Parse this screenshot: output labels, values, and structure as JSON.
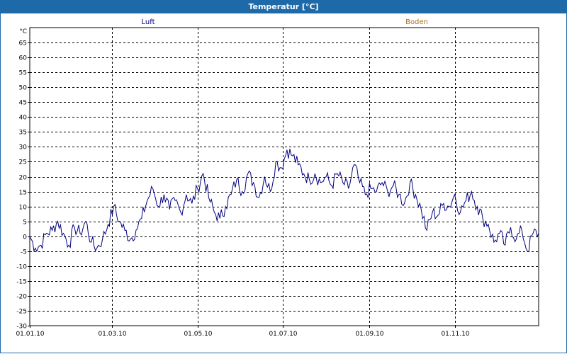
{
  "window": {
    "title": "Temperatur [°C]"
  },
  "chart_data": {
    "type": "line",
    "ylabel": "°C",
    "ylim": [
      -30,
      70
    ],
    "yticks": [
      65,
      60,
      55,
      50,
      45,
      40,
      35,
      30,
      25,
      20,
      15,
      10,
      5,
      0,
      -5,
      -10,
      -15,
      -20,
      -25,
      -30
    ],
    "xlim": [
      "2010-01-01",
      "2010-12-31"
    ],
    "xticks": [
      {
        "date": "2010-01-01",
        "label": "01.01.10"
      },
      {
        "date": "2010-03-01",
        "label": "01.03.10"
      },
      {
        "date": "2010-05-01",
        "label": "01.05.10"
      },
      {
        "date": "2010-07-01",
        "label": "01.07.10"
      },
      {
        "date": "2010-09-01",
        "label": "01.09.10"
      },
      {
        "date": "2010-11-01",
        "label": "01.11.10"
      }
    ],
    "grid": true,
    "legend_position": "top",
    "series": [
      {
        "name": "Luft",
        "color": "#000080",
        "points": [
          [
            "2010-01-01",
            0
          ],
          [
            "2010-01-05",
            -4
          ],
          [
            "2010-01-09",
            -3
          ],
          [
            "2010-01-13",
            1
          ],
          [
            "2010-01-17",
            2
          ],
          [
            "2010-01-21",
            5
          ],
          [
            "2010-01-25",
            1
          ],
          [
            "2010-01-29",
            -3
          ],
          [
            "2010-02-02",
            3
          ],
          [
            "2010-02-06",
            1
          ],
          [
            "2010-02-10",
            5
          ],
          [
            "2010-02-14",
            -2
          ],
          [
            "2010-02-18",
            -4
          ],
          [
            "2010-02-22",
            -1
          ],
          [
            "2010-02-26",
            4
          ],
          [
            "2010-03-02",
            10
          ],
          [
            "2010-03-06",
            5
          ],
          [
            "2010-03-10",
            2
          ],
          [
            "2010-03-14",
            -1
          ],
          [
            "2010-03-18",
            2
          ],
          [
            "2010-03-22",
            6
          ],
          [
            "2010-03-26",
            12
          ],
          [
            "2010-03-30",
            16
          ],
          [
            "2010-04-03",
            10
          ],
          [
            "2010-04-07",
            14
          ],
          [
            "2010-04-11",
            9
          ],
          [
            "2010-04-15",
            12
          ],
          [
            "2010-04-19",
            8
          ],
          [
            "2010-04-23",
            14
          ],
          [
            "2010-04-27",
            11
          ],
          [
            "2010-05-01",
            16
          ],
          [
            "2010-05-05",
            21
          ],
          [
            "2010-05-09",
            13
          ],
          [
            "2010-05-13",
            8
          ],
          [
            "2010-05-17",
            6
          ],
          [
            "2010-05-21",
            10
          ],
          [
            "2010-05-25",
            14
          ],
          [
            "2010-05-29",
            19
          ],
          [
            "2010-06-02",
            15
          ],
          [
            "2010-06-06",
            21
          ],
          [
            "2010-06-10",
            18
          ],
          [
            "2010-06-14",
            13
          ],
          [
            "2010-06-18",
            20
          ],
          [
            "2010-06-22",
            15
          ],
          [
            "2010-06-26",
            25
          ],
          [
            "2010-06-30",
            23
          ],
          [
            "2010-07-04",
            29
          ],
          [
            "2010-07-08",
            27
          ],
          [
            "2010-07-12",
            24
          ],
          [
            "2010-07-16",
            21
          ],
          [
            "2010-07-20",
            19
          ],
          [
            "2010-07-24",
            21
          ],
          [
            "2010-07-28",
            18
          ],
          [
            "2010-08-01",
            20
          ],
          [
            "2010-08-05",
            17
          ],
          [
            "2010-08-09",
            21
          ],
          [
            "2010-08-13",
            18
          ],
          [
            "2010-08-17",
            16
          ],
          [
            "2010-08-21",
            24
          ],
          [
            "2010-08-25",
            18
          ],
          [
            "2010-08-29",
            14
          ],
          [
            "2010-09-02",
            16
          ],
          [
            "2010-09-06",
            15
          ],
          [
            "2010-09-10",
            18
          ],
          [
            "2010-09-14",
            15
          ],
          [
            "2010-09-18",
            17
          ],
          [
            "2010-09-22",
            14
          ],
          [
            "2010-09-26",
            11
          ],
          [
            "2010-09-30",
            18
          ],
          [
            "2010-10-04",
            14
          ],
          [
            "2010-10-08",
            9
          ],
          [
            "2010-10-12",
            2
          ],
          [
            "2010-10-16",
            8
          ],
          [
            "2010-10-20",
            7
          ],
          [
            "2010-10-24",
            11
          ],
          [
            "2010-10-28",
            10
          ],
          [
            "2010-11-01",
            14
          ],
          [
            "2010-11-05",
            8
          ],
          [
            "2010-11-09",
            12
          ],
          [
            "2010-11-13",
            15
          ],
          [
            "2010-11-17",
            10
          ],
          [
            "2010-11-21",
            6
          ],
          [
            "2010-11-25",
            4
          ],
          [
            "2010-11-29",
            -2
          ],
          [
            "2010-12-03",
            1
          ],
          [
            "2010-12-07",
            -3
          ],
          [
            "2010-12-11",
            3
          ],
          [
            "2010-12-15",
            -1
          ],
          [
            "2010-12-19",
            2
          ],
          [
            "2010-12-23",
            -5
          ],
          [
            "2010-12-27",
            1
          ],
          [
            "2010-12-31",
            1
          ]
        ]
      },
      {
        "name": "Boden",
        "color": "#b86a10",
        "points": []
      }
    ]
  }
}
